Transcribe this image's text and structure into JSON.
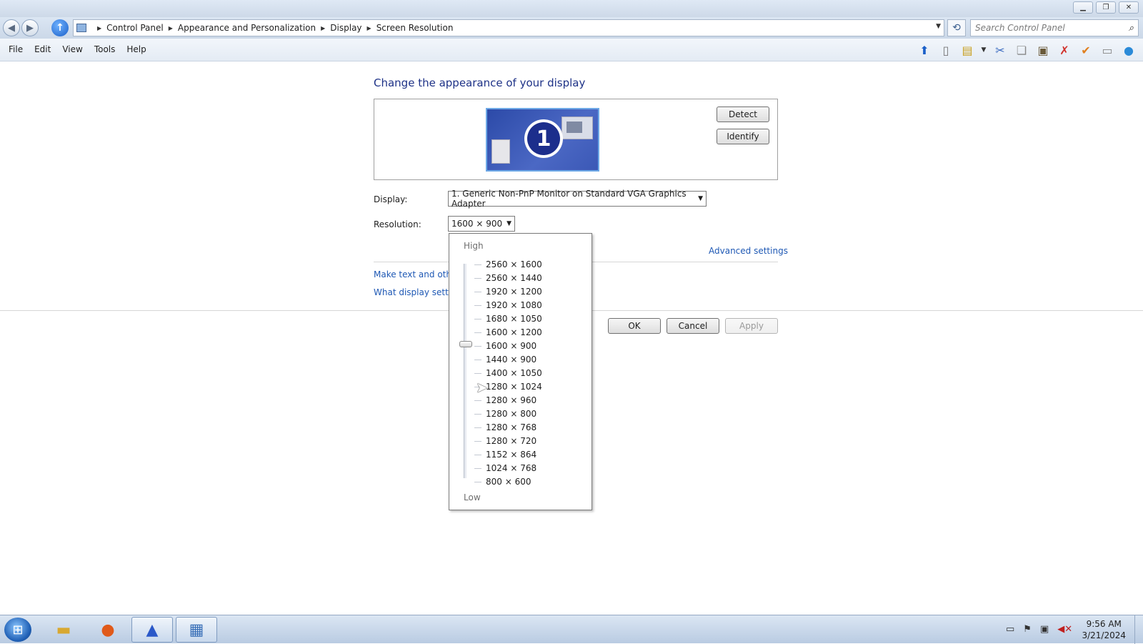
{
  "breadcrumbs": [
    "Control Panel",
    "Appearance and Personalization",
    "Display",
    "Screen Resolution"
  ],
  "search": {
    "placeholder": "Search Control Panel"
  },
  "menu": [
    "File",
    "Edit",
    "View",
    "Tools",
    "Help"
  ],
  "content": {
    "heading": "Change the appearance of your display",
    "monitor_number": "1",
    "detect_label": "Detect",
    "identify_label": "Identify",
    "display_label": "Display:",
    "display_value": "1. Generic Non-PnP Monitor on Standard VGA Graphics Adapter",
    "resolution_label": "Resolution:",
    "resolution_value": "1600 × 900",
    "advanced_settings": "Advanced settings",
    "link_text_size": "Make text and other",
    "link_display_settings": "What display settings",
    "ok_label": "OK",
    "cancel_label": "Cancel",
    "apply_label": "Apply"
  },
  "resolution_dropdown": {
    "high_label": "High",
    "low_label": "Low",
    "selected": "1600 × 900",
    "options": [
      "2560 × 1600",
      "2560 × 1440",
      "1920 × 1200",
      "1920 × 1080",
      "1680 × 1050",
      "1600 × 1200",
      "1600 × 900",
      "1440 × 900",
      "1400 × 1050",
      "1280 × 1024",
      "1280 × 960",
      "1280 × 800",
      "1280 × 768",
      "1280 × 720",
      "1152 × 864",
      "1024 × 768",
      "800 × 600"
    ]
  },
  "taskbar": {
    "time": "9:56 AM",
    "date": "3/21/2024"
  },
  "colors": {
    "link": "#1e58b4",
    "heading": "#1e3287",
    "monitor_bg": "#2c4aa8"
  }
}
